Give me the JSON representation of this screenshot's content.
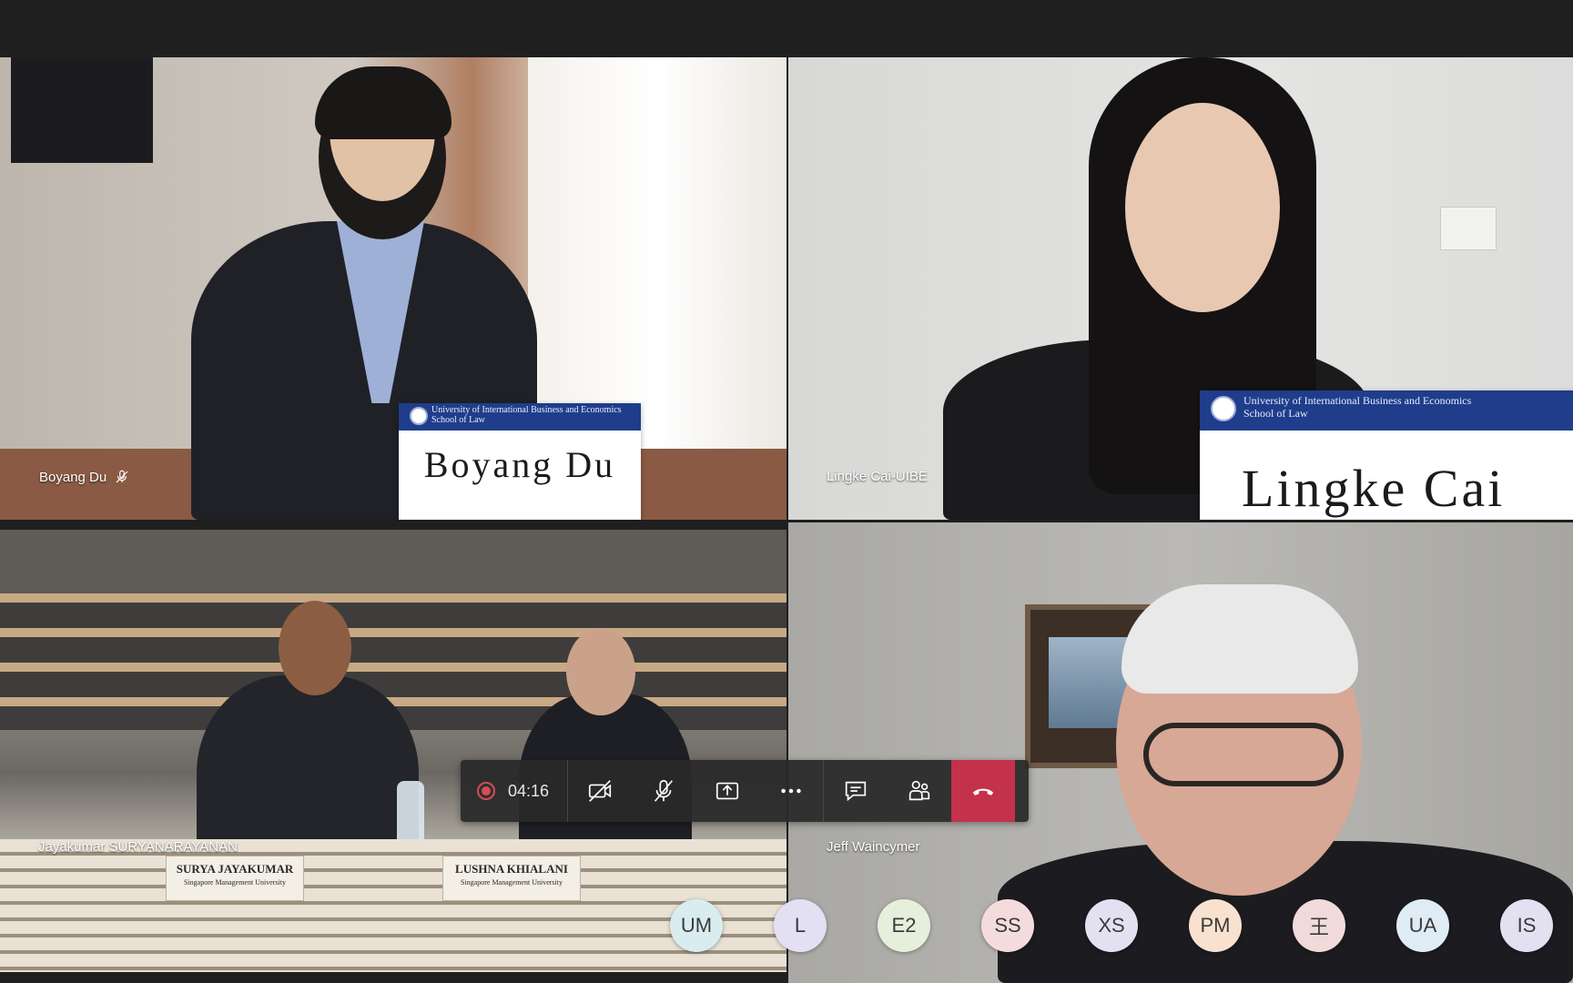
{
  "participants": {
    "top_left": {
      "name": "Boyang Du",
      "placard_name": "Boyang Du",
      "placard_institution": "University of International Business and Economics\nSchool of Law",
      "muted": true
    },
    "top_right": {
      "name": "Lingke Cai-UIBE",
      "placard_name": "Lingke Cai",
      "placard_institution": "University of International Business and Economics\nSchool of Law"
    },
    "bottom_left": {
      "name": "Jayakumar SURYANARAYANAN",
      "desk_card_1_name": "SURYA JAYAKUMAR",
      "desk_card_1_sub": "Singapore Management University",
      "desk_card_2_name": "LUSHNA KHIALANI",
      "desk_card_2_sub": "Singapore Management University"
    },
    "bottom_right": {
      "name": "Jeff Waincymer"
    }
  },
  "controls": {
    "timer": "04:16",
    "icons": {
      "record": "record-icon",
      "camera": "camera-off-icon",
      "mic": "mic-off-icon",
      "share": "share-screen-icon",
      "more": "more-icon",
      "chat": "chat-icon",
      "people": "people-icon",
      "hangup": "hangup-icon"
    },
    "colors": {
      "hangup": "#c4314b",
      "record": "#d24d57"
    }
  },
  "avatars": [
    {
      "initials": "UM",
      "color": "#d9ecf0"
    },
    {
      "initials": "L",
      "color": "#e2e0f2"
    },
    {
      "initials": "E2",
      "color": "#e6eedc"
    },
    {
      "initials": "SS",
      "color": "#f5dcdc"
    },
    {
      "initials": "XS",
      "color": "#e3e0f2"
    },
    {
      "initials": "PM",
      "color": "#f8e2cf"
    },
    {
      "initials": "王",
      "color": "#f0dada"
    },
    {
      "initials": "UA",
      "color": "#e0ecf5"
    },
    {
      "initials": "IS",
      "color": "#e3e0f2"
    }
  ]
}
